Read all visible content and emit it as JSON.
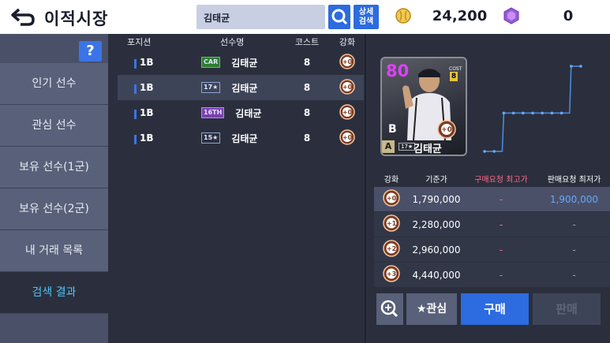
{
  "header": {
    "title": "이적시장",
    "search_value": "김태균",
    "detail_search_label": "상세\n검색",
    "coins": "24,200",
    "gems": "0"
  },
  "sidebar": {
    "help_label": "?",
    "items": [
      {
        "label": "인기 선수"
      },
      {
        "label": "관심 선수"
      },
      {
        "label": "보유 선수(1군)"
      },
      {
        "label": "보유 선수(2군)"
      },
      {
        "label": "내 거래 목록"
      },
      {
        "label": "검색 결과"
      }
    ]
  },
  "list": {
    "headers": [
      "포지션",
      "선수명",
      "코스트",
      "강화"
    ],
    "rows": [
      {
        "pos": "1B",
        "tag": "CAR",
        "name": "김태균",
        "cost": "8",
        "enh": "+0"
      },
      {
        "pos": "1B",
        "tag": "17★",
        "name": "김태균",
        "cost": "8",
        "enh": "+0"
      },
      {
        "pos": "1B",
        "tag": "16TH",
        "name": "김태균",
        "cost": "8",
        "enh": "+0"
      },
      {
        "pos": "1B",
        "tag": "15★",
        "name": "김태균",
        "cost": "8",
        "enh": "+0"
      }
    ]
  },
  "card": {
    "ovr": "80",
    "cost_label": "COST",
    "cost": "8",
    "grade_b": "B",
    "grade_a": "A",
    "tag": "17★",
    "name": "김태균",
    "enh": "+0"
  },
  "chart_data": {
    "type": "line",
    "x": [
      1,
      2,
      3,
      4,
      5,
      6,
      7,
      8,
      9,
      10,
      11
    ],
    "values": [
      0.0,
      0.0,
      0.45,
      0.45,
      0.45,
      0.45,
      0.45,
      0.45,
      0.45,
      1.0,
      1.0
    ],
    "title": "",
    "xlabel": "",
    "ylabel": ""
  },
  "price_table": {
    "headers": [
      "강화",
      "기준가",
      "구매요청 최고가",
      "판매요청 최저가"
    ],
    "rows": [
      {
        "enh": "+0",
        "base": "1,790,000",
        "buy": "-",
        "sell": "1,900,000"
      },
      {
        "enh": "+1",
        "base": "2,280,000",
        "buy": "-",
        "sell": "-"
      },
      {
        "enh": "+2",
        "base": "2,960,000",
        "buy": "-",
        "sell": "-"
      },
      {
        "enh": "+3",
        "base": "4,440,000",
        "buy": "-",
        "sell": "-"
      }
    ]
  },
  "buttons": {
    "fav": "★관심",
    "buy": "구매",
    "sell": "판매"
  },
  "colors": {
    "accent": "#2c6be0",
    "pink": "#ff6b8a",
    "blue": "#6aa8ff",
    "active": "#4fc3f7"
  }
}
